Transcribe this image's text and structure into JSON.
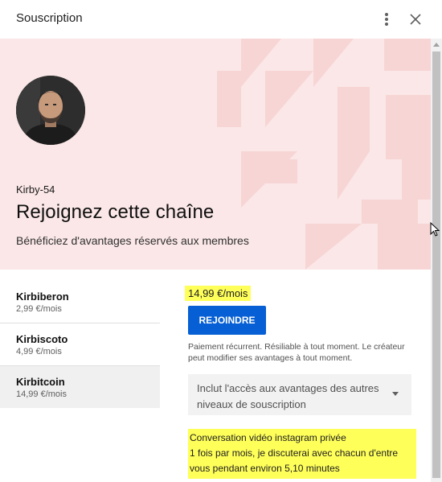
{
  "dialog": {
    "title": "Souscription"
  },
  "hero": {
    "channel_name": "Kirby-54",
    "headline": "Rejoignez cette chaîne",
    "subline": "Bénéficiez d'avantages réservés aux membres"
  },
  "tiers": [
    {
      "name": "Kirbiberon",
      "price": "2,99 €/mois",
      "selected": false
    },
    {
      "name": "Kirbiscoto",
      "price": "4,99 €/mois",
      "selected": false
    },
    {
      "name": "Kirbitcoin",
      "price": "14,99 €/mois",
      "selected": true
    }
  ],
  "detail": {
    "price": "14,99 €/mois",
    "join_label": "REJOINDRE",
    "note": "Paiement récurrent. Résiliable à tout moment. Le créateur peut modifier ses avantages à tout moment.",
    "perk_select": "Inclut l'accès aux avantages des autres niveaux de souscription",
    "perk_lines": [
      "Conversation vidéo instagram privée",
      "1 fois par mois, je discuterai avec chacun d'entre",
      "vous pendant environ 5,10 minutes"
    ]
  },
  "colors": {
    "hero_background": "#fbe7e7",
    "accent_button": "#065fd4",
    "highlight": "#ffff5a"
  }
}
